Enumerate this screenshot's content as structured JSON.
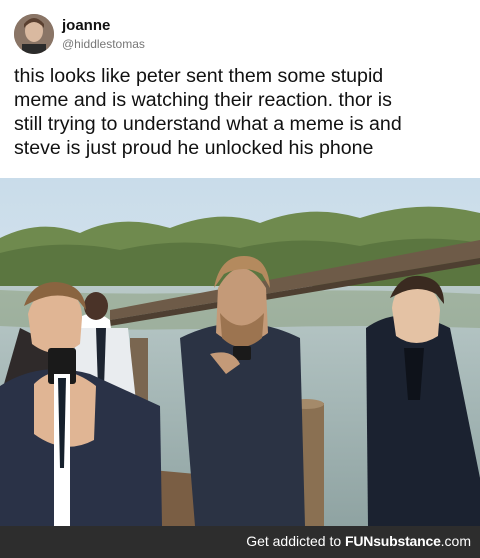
{
  "tweet": {
    "username": "joanne",
    "handle": "@hiddlestomas",
    "lines": [
      "this looks like peter sent them some stupid",
      "meme and is watching their reaction. thor is",
      "still trying to understand what a meme is and",
      "steve is just proud he unlocked his phone"
    ]
  },
  "footer": {
    "prefix": "Get addicted to ",
    "brand": "FUNsubstance",
    "suffix": ".com"
  },
  "colors": {
    "footer_bg": "#2d2d2d",
    "text": "#111111",
    "handle": "#777777"
  },
  "icons": {
    "avatar": "profile-photo",
    "photo": "lakeside-photo"
  }
}
